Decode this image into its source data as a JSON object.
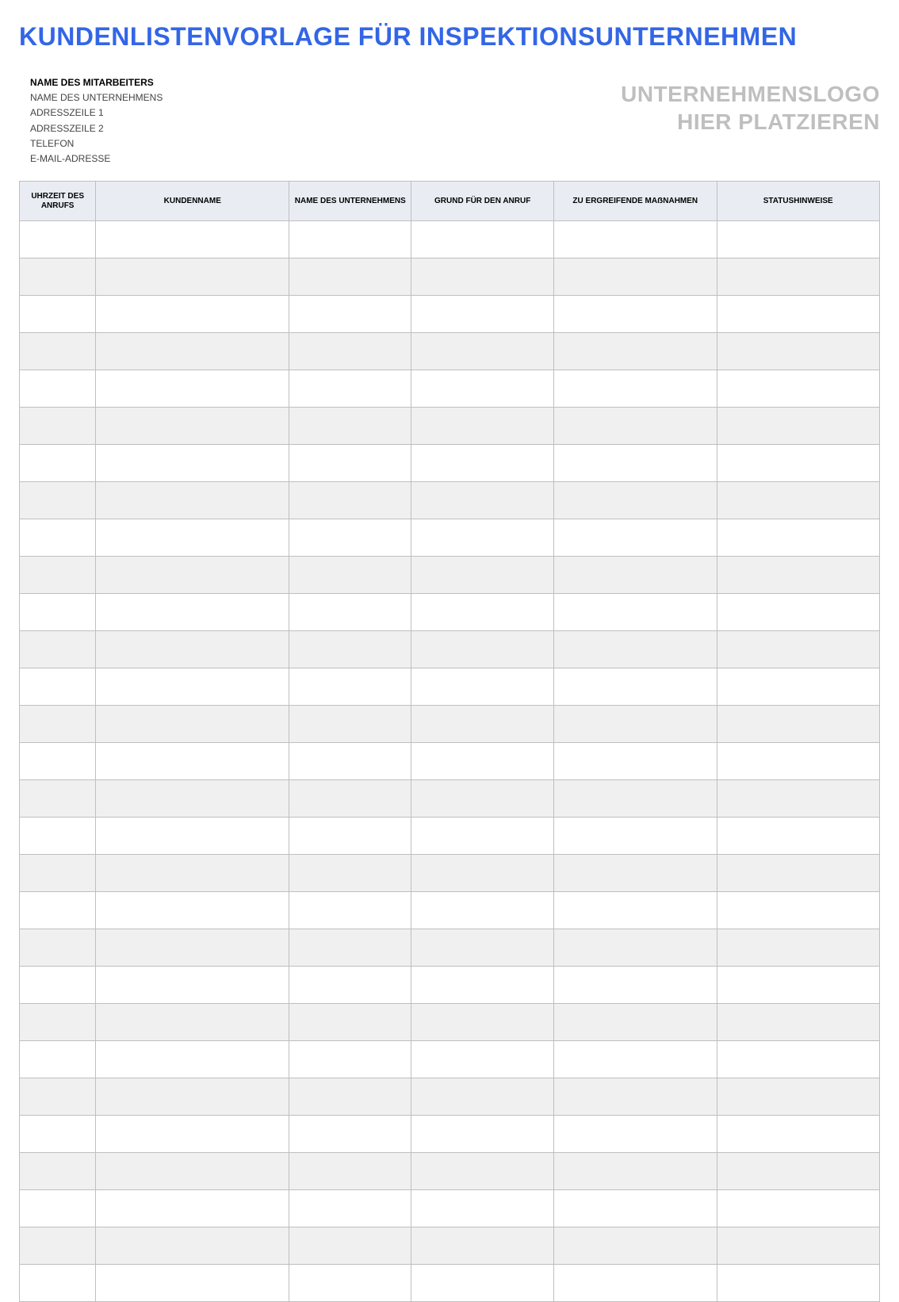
{
  "title": "KUNDENLISTENVORLAGE FÜR INSPEKTIONSUNTERNEHMEN",
  "info": {
    "employee_label": "NAME DES MITARBEITERS",
    "company_label": "NAME DES UNTERNEHMENS",
    "addr1_label": "ADRESSZEILE 1",
    "addr2_label": "ADRESSZEILE 2",
    "phone_label": "TELEFON",
    "email_label": "E-MAIL-ADRESSE"
  },
  "logo": {
    "line1": "UNTERNEHMENSLOGO",
    "line2": "HIER PLATZIEREN"
  },
  "columns": [
    "UHRZEIT DES ANRUFS",
    "KUNDENNAME",
    "NAME DES UNTERNEHMENS",
    "GRUND FÜR DEN ANRUF",
    "ZU ERGREIFENDE MAẞNAHMEN",
    "STATUSHINWEISE"
  ],
  "rows": [
    {
      "time": "",
      "customer": "",
      "company": "",
      "reason": "",
      "action": "",
      "status": ""
    },
    {
      "time": "",
      "customer": "",
      "company": "",
      "reason": "",
      "action": "",
      "status": ""
    },
    {
      "time": "",
      "customer": "",
      "company": "",
      "reason": "",
      "action": "",
      "status": ""
    },
    {
      "time": "",
      "customer": "",
      "company": "",
      "reason": "",
      "action": "",
      "status": ""
    },
    {
      "time": "",
      "customer": "",
      "company": "",
      "reason": "",
      "action": "",
      "status": ""
    },
    {
      "time": "",
      "customer": "",
      "company": "",
      "reason": "",
      "action": "",
      "status": ""
    },
    {
      "time": "",
      "customer": "",
      "company": "",
      "reason": "",
      "action": "",
      "status": ""
    },
    {
      "time": "",
      "customer": "",
      "company": "",
      "reason": "",
      "action": "",
      "status": ""
    },
    {
      "time": "",
      "customer": "",
      "company": "",
      "reason": "",
      "action": "",
      "status": ""
    },
    {
      "time": "",
      "customer": "",
      "company": "",
      "reason": "",
      "action": "",
      "status": ""
    },
    {
      "time": "",
      "customer": "",
      "company": "",
      "reason": "",
      "action": "",
      "status": ""
    },
    {
      "time": "",
      "customer": "",
      "company": "",
      "reason": "",
      "action": "",
      "status": ""
    },
    {
      "time": "",
      "customer": "",
      "company": "",
      "reason": "",
      "action": "",
      "status": ""
    },
    {
      "time": "",
      "customer": "",
      "company": "",
      "reason": "",
      "action": "",
      "status": ""
    },
    {
      "time": "",
      "customer": "",
      "company": "",
      "reason": "",
      "action": "",
      "status": ""
    },
    {
      "time": "",
      "customer": "",
      "company": "",
      "reason": "",
      "action": "",
      "status": ""
    },
    {
      "time": "",
      "customer": "",
      "company": "",
      "reason": "",
      "action": "",
      "status": ""
    },
    {
      "time": "",
      "customer": "",
      "company": "",
      "reason": "",
      "action": "",
      "status": ""
    },
    {
      "time": "",
      "customer": "",
      "company": "",
      "reason": "",
      "action": "",
      "status": ""
    },
    {
      "time": "",
      "customer": "",
      "company": "",
      "reason": "",
      "action": "",
      "status": ""
    },
    {
      "time": "",
      "customer": "",
      "company": "",
      "reason": "",
      "action": "",
      "status": ""
    },
    {
      "time": "",
      "customer": "",
      "company": "",
      "reason": "",
      "action": "",
      "status": ""
    },
    {
      "time": "",
      "customer": "",
      "company": "",
      "reason": "",
      "action": "",
      "status": ""
    },
    {
      "time": "",
      "customer": "",
      "company": "",
      "reason": "",
      "action": "",
      "status": ""
    },
    {
      "time": "",
      "customer": "",
      "company": "",
      "reason": "",
      "action": "",
      "status": ""
    },
    {
      "time": "",
      "customer": "",
      "company": "",
      "reason": "",
      "action": "",
      "status": ""
    },
    {
      "time": "",
      "customer": "",
      "company": "",
      "reason": "",
      "action": "",
      "status": ""
    },
    {
      "time": "",
      "customer": "",
      "company": "",
      "reason": "",
      "action": "",
      "status": ""
    },
    {
      "time": "",
      "customer": "",
      "company": "",
      "reason": "",
      "action": "",
      "status": ""
    }
  ]
}
